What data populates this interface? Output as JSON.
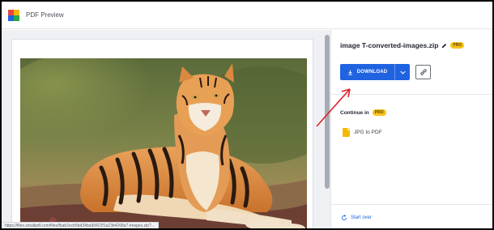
{
  "app": {
    "title": "PDF Preview",
    "logo_colors": [
      "#e8473f",
      "#f5b800",
      "#1f63e0",
      "#2aa84a"
    ]
  },
  "preview": {
    "status_url": "https://files.smallpdf.com/files/fbab2ecb5bd34ba99422f1a23b4268a7-images.zip?..."
  },
  "panel": {
    "file_name": "image T-converted-images.zip",
    "pro_badge": "PRO",
    "download_label": "DOWNLOAD",
    "continue_label": "Continue in",
    "continue_badge": "PRO",
    "tools": [
      {
        "label": "JPG to PDF",
        "icon": "jpg-file-icon"
      }
    ],
    "start_over_label": "Start over"
  },
  "colors": {
    "accent": "#1f63e0",
    "pro": "#f8c21c",
    "annotation": "#e0202a"
  }
}
